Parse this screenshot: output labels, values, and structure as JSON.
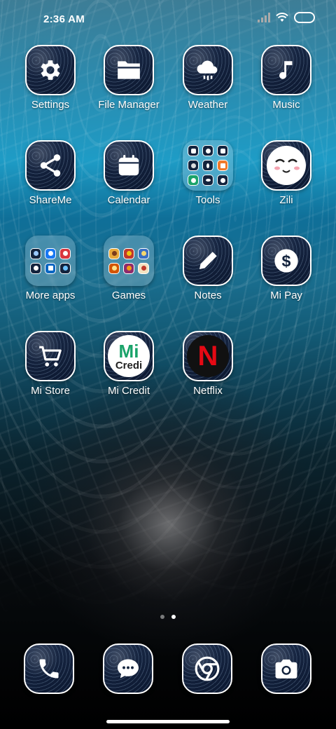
{
  "status_bar": {
    "time": "2:36 AM",
    "icons": [
      "signal-icon",
      "wifi-icon",
      "battery-icon"
    ]
  },
  "home": {
    "rows": [
      [
        {
          "label": "Settings",
          "icon": "gear-icon"
        },
        {
          "label": "File Manager",
          "icon": "folder-icon"
        },
        {
          "label": "Weather",
          "icon": "cloud-rain-icon"
        },
        {
          "label": "Music",
          "icon": "music-note-icon"
        }
      ],
      [
        {
          "label": "ShareMe",
          "icon": "share-icon"
        },
        {
          "label": "Calendar",
          "icon": "calendar-icon"
        },
        {
          "label": "Tools",
          "icon": "folder-tools-icon"
        },
        {
          "label": "Zili",
          "icon": "zili-face-icon"
        }
      ],
      [
        {
          "label": "More apps",
          "icon": "folder-more-apps-icon"
        },
        {
          "label": "Games",
          "icon": "folder-games-icon"
        },
        {
          "label": "Notes",
          "icon": "pencil-icon"
        },
        {
          "label": "Mi Pay",
          "icon": "dollar-coin-icon"
        }
      ],
      [
        {
          "label": "Mi Store",
          "icon": "shopping-cart-icon"
        },
        {
          "label": "Mi Credit",
          "icon": "mi-credit-logo-icon",
          "logo_text": "Mi",
          "logo_subtext": "Credi"
        },
        {
          "label": "Netflix",
          "icon": "netflix-logo-icon",
          "logo_text": "N"
        }
      ]
    ]
  },
  "page_indicator": {
    "pages": 2,
    "active": 2
  },
  "dock": [
    {
      "name": "phone",
      "icon": "phone-icon"
    },
    {
      "name": "messages",
      "icon": "chat-bubble-icon"
    },
    {
      "name": "chrome",
      "icon": "chrome-icon"
    },
    {
      "name": "camera",
      "icon": "camera-icon"
    }
  ],
  "colors": {
    "netflix_red": "#e50914",
    "mi_credit_green": "#1aa36a",
    "mi_pay_circle": "#ffffff"
  }
}
